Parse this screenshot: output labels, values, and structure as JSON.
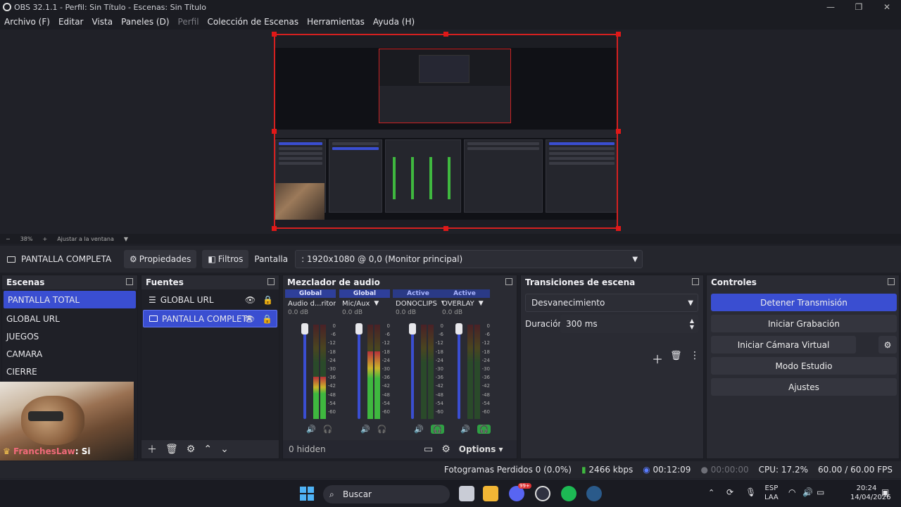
{
  "window": {
    "title": "OBS 32.1.1 - Perfil: Sin Título - Escenas: Sin Título"
  },
  "menu": [
    {
      "label": "Archivo (F)",
      "disabled": false
    },
    {
      "label": "Editar",
      "disabled": false
    },
    {
      "label": "Vista",
      "disabled": false
    },
    {
      "label": "Paneles (D)",
      "disabled": false
    },
    {
      "label": "Perfil",
      "disabled": true
    },
    {
      "label": "Colección de Escenas",
      "disabled": false
    },
    {
      "label": "Herramientas",
      "disabled": false
    },
    {
      "label": "Ayuda (H)",
      "disabled": false
    }
  ],
  "zoom": {
    "minus": "−",
    "value": "38%",
    "plus": "+",
    "fit": "Ajustar a la ventana"
  },
  "source_toolbar": {
    "current_source": "PANTALLA COMPLETA",
    "properties": "Propiedades",
    "filters": "Filtros",
    "display_label": "Pantalla",
    "display_value": ": 1920x1080 @ 0,0 (Monitor principal)"
  },
  "scenes": {
    "title": "Escenas",
    "items": [
      "PANTALLA TOTAL",
      "GLOBAL URL",
      "JUEGOS",
      "CAMARA",
      "CIERRE"
    ],
    "selected_index": 0
  },
  "sources": {
    "title": "Fuentes",
    "items": [
      {
        "label": "GLOBAL URL",
        "selected": false
      },
      {
        "label": "PANTALLA COMPLETA",
        "selected": true
      }
    ]
  },
  "mixer": {
    "title": "Mezclador de audio",
    "hidden_label": "0 hidden",
    "options_label": "Options",
    "scale": [
      "0",
      "-6",
      "-12",
      "-18",
      "-24",
      "-30",
      "-36",
      "-42",
      "-48",
      "-54",
      "-60"
    ],
    "channels": [
      {
        "badge": "Global",
        "name": "Audio d...ritorio",
        "db": "0.0 dB",
        "level": 0.45,
        "badge_state": "global"
      },
      {
        "badge": "Global",
        "name": "Mic/Aux",
        "db": "0.0 dB",
        "level": 0.72,
        "badge_state": "global"
      },
      {
        "badge": "Active",
        "name": "DONOCLIPS",
        "db": "0.0 dB",
        "level": 0.0,
        "badge_state": "active"
      },
      {
        "badge": "Active",
        "name": "OVERLAY",
        "db": "0.0 dB",
        "level": 0.0,
        "badge_state": "active"
      }
    ]
  },
  "transitions": {
    "title": "Transiciones de escena",
    "selected": "Desvanecimiento",
    "duration_label": "Duración",
    "duration_value": "300 ms"
  },
  "controls": {
    "title": "Controles",
    "buttons": [
      "Detener Transmisión",
      "Iniciar Grabación",
      "Iniciar Cámara Virtual",
      "Modo Estudio",
      "Ajustes"
    ]
  },
  "webcam": {
    "user": "FranchesLaw",
    "message": ": Si"
  },
  "status": {
    "dropped": "Fotogramas Perdidos 0 (0.0%)",
    "bitrate": "2466 kbps",
    "stream_time": "00:12:09",
    "rec_time": "00:00:00",
    "cpu": "CPU: 17.2%",
    "fps": "60.00 / 60.00 FPS"
  },
  "taskbar": {
    "search": "Buscar",
    "lang_top": "ESP",
    "lang_bottom": "LAA",
    "time": "20:24",
    "date": "14/04/2026",
    "discord_badge": "99+"
  },
  "colors": {
    "accent": "#3a4ed1",
    "preview_border": "#d52020",
    "meter_green": "#3fb83f",
    "meter_yellow": "#c9b42a",
    "meter_red": "#b8303a"
  }
}
